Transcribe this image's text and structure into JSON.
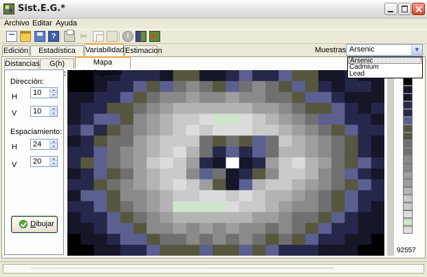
{
  "window": {
    "title": "Sist.E.G.*"
  },
  "menu": [
    "Archivo",
    "Editar",
    "Ayuda"
  ],
  "toolbar_icons": [
    "new-file-icon",
    "open-folder-icon",
    "save-icon",
    "help-icon",
    "print-icon",
    "cut-icon",
    "copy-icon",
    "paste-icon",
    "info-icon",
    "grid-map-icon",
    "exit-icon"
  ],
  "main_tabs": [
    "Edición",
    "Estadística Básica",
    "Variabilidad",
    "Estimacion"
  ],
  "main_tab_active": "Variabilidad",
  "muestras": {
    "label": "Muestras:",
    "selected": "Arsenic",
    "options": [
      "Arsenic",
      "Cadmium",
      "Lead"
    ]
  },
  "sub_tabs": [
    "Distancias",
    "G(h) Direc",
    "Mapa Variograma"
  ],
  "sub_tab_active": "Mapa Variograma",
  "panel": {
    "direccion_label": "Dirección:",
    "h_label": "H",
    "v_label": "V",
    "dir_h": "10",
    "dir_v": "10",
    "espaciamiento_label": "Espaciamiento:",
    "esp_h_label": "H",
    "esp_v_label": "V",
    "esp_h": "24",
    "esp_v": "20",
    "draw_button_label": "Dibujar"
  },
  "colorbar": {
    "max_label": "92557"
  },
  "chart_data": {
    "type": "heatmap",
    "title": "",
    "xlabel": "",
    "ylabel": "",
    "palette": [
      "#000000",
      "#151628",
      "#25284a",
      "#5c6090",
      "#56573e",
      "#707070",
      "#8a8a8a",
      "#9e9e9e",
      "#b4b4b4",
      "#cacaca",
      "#dcdcdc",
      "#cfe6cc",
      "#ffffff"
    ],
    "grid": [
      [
        0,
        0,
        1,
        1,
        2,
        2,
        2,
        1,
        4,
        4,
        1,
        1,
        2,
        3,
        2,
        2,
        3,
        4,
        4,
        1,
        1,
        2,
        1,
        1
      ],
      [
        0,
        0,
        1,
        2,
        2,
        3,
        4,
        3,
        5,
        6,
        5,
        4,
        3,
        5,
        6,
        5,
        4,
        3,
        4,
        2,
        1,
        2,
        2,
        1
      ],
      [
        1,
        1,
        2,
        2,
        3,
        4,
        5,
        6,
        6,
        7,
        6,
        6,
        7,
        6,
        6,
        5,
        5,
        4,
        3,
        3,
        2,
        1,
        1,
        1
      ],
      [
        1,
        2,
        2,
        4,
        4,
        5,
        6,
        7,
        8,
        8,
        8,
        8,
        8,
        8,
        7,
        7,
        6,
        5,
        4,
        4,
        3,
        2,
        1,
        2
      ],
      [
        1,
        2,
        3,
        3,
        4,
        6,
        7,
        8,
        9,
        9,
        10,
        11,
        11,
        10,
        9,
        8,
        7,
        6,
        5,
        3,
        3,
        2,
        2,
        1
      ],
      [
        2,
        3,
        2,
        4,
        5,
        6,
        7,
        8,
        9,
        10,
        9,
        10,
        10,
        10,
        9,
        9,
        8,
        7,
        6,
        5,
        4,
        3,
        2,
        2
      ],
      [
        1,
        2,
        4,
        5,
        5,
        7,
        8,
        9,
        9,
        9,
        5,
        4,
        5,
        4,
        3,
        5,
        9,
        8,
        7,
        6,
        5,
        4,
        2,
        1
      ],
      [
        2,
        2,
        3,
        5,
        6,
        7,
        8,
        9,
        10,
        8,
        5,
        2,
        3,
        2,
        3,
        5,
        8,
        8,
        7,
        6,
        5,
        4,
        2,
        1
      ],
      [
        2,
        4,
        3,
        5,
        6,
        7,
        9,
        10,
        9,
        7,
        2,
        1,
        12,
        1,
        2,
        7,
        9,
        10,
        8,
        7,
        5,
        4,
        3,
        2
      ],
      [
        1,
        2,
        3,
        4,
        5,
        7,
        8,
        9,
        9,
        6,
        3,
        5,
        1,
        2,
        4,
        6,
        9,
        9,
        8,
        6,
        5,
        3,
        2,
        1
      ],
      [
        2,
        2,
        4,
        5,
        6,
        7,
        8,
        9,
        10,
        9,
        7,
        4,
        1,
        3,
        8,
        9,
        9,
        8,
        7,
        6,
        5,
        4,
        3,
        2
      ],
      [
        1,
        3,
        3,
        4,
        6,
        6,
        7,
        8,
        9,
        9,
        10,
        10,
        9,
        10,
        9,
        8,
        8,
        7,
        6,
        5,
        4,
        3,
        2,
        2
      ],
      [
        2,
        2,
        3,
        4,
        5,
        6,
        7,
        8,
        11,
        11,
        11,
        11,
        10,
        9,
        9,
        8,
        7,
        6,
        6,
        5,
        4,
        3,
        2,
        1
      ],
      [
        1,
        2,
        2,
        3,
        4,
        5,
        6,
        7,
        8,
        8,
        8,
        8,
        8,
        8,
        7,
        7,
        6,
        5,
        5,
        4,
        3,
        2,
        1,
        1
      ],
      [
        1,
        1,
        2,
        3,
        3,
        4,
        6,
        6,
        7,
        6,
        7,
        6,
        7,
        6,
        6,
        5,
        6,
        5,
        4,
        3,
        2,
        2,
        1,
        1
      ],
      [
        0,
        1,
        1,
        2,
        3,
        3,
        4,
        5,
        5,
        6,
        5,
        6,
        5,
        6,
        5,
        4,
        5,
        4,
        3,
        2,
        2,
        1,
        1,
        0
      ],
      [
        0,
        0,
        1,
        1,
        2,
        2,
        3,
        4,
        4,
        4,
        3,
        4,
        4,
        3,
        4,
        3,
        2,
        2,
        2,
        1,
        1,
        1,
        0,
        0
      ]
    ],
    "colorbar_steps": [
      0,
      0,
      1,
      1,
      2,
      2,
      3,
      4,
      4,
      5,
      5,
      6,
      6,
      7,
      7,
      8,
      9,
      9,
      10,
      11,
      10
    ]
  }
}
